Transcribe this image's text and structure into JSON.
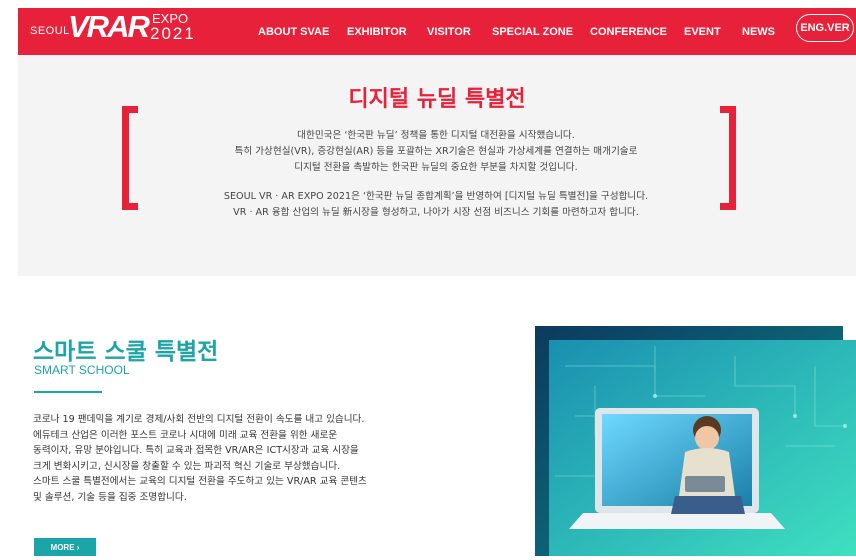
{
  "header": {
    "logo": {
      "seoul": "SEOUL",
      "vrar": "VRAR",
      "expo": "EXPO",
      "year": "2021"
    },
    "nav": [
      "ABOUT SVAE",
      "EXHIBITOR",
      "VISITOR",
      "SPECIAL ZONE",
      "CONFERENCE",
      "EVENT",
      "NEWS"
    ],
    "lang_button": "ENG.VER"
  },
  "intro": {
    "title": "디지털 뉴딜 특별전",
    "lines": [
      "대한민국은 ‘한국판 뉴딜’ 정책을 통한 디지털 대전환을 시작했습니다.",
      "특히 가상현실(VR), 증강현실(AR) 등을 포괄하는 XR기술은 현실과 가상세계를 연결하는 매개기술로",
      "디지털 전환을 촉발하는 한국판 뉴딜의 중요한 부분을 차지할 것입니다.",
      "SEOUL VR · AR EXPO 2021은 ‘한국판 뉴딜 종합계획’을 반영하여 [디지털 뉴딜 특별전]을 구성합니다.",
      "VR · AR 융합 산업의 뉴딜 新시장을 형성하고, 나아가 시장 선점 비즈니스 기회를 마련하고자 합니다."
    ]
  },
  "smart": {
    "title": "스마트 스쿨 특별전",
    "subtitle": "SMART SCHOOL",
    "lines": [
      "코로나 19 팬데믹을 계기로 경제/사회 전반의 디지털 전환이 속도를 내고 있습니다.",
      "에듀테크 산업은 이러한 포스트 코로나 시대에 미래 교육 전환을 위한 새로운",
      "동력이자, 유망 분야입니다. 특히 교육과 접목한 VR/AR은 ICT시장과 교육 시장을",
      "크게 변화시키고, 신시장을 창출할 수 있는 파괴적 혁신 기술로 부상했습니다.",
      "스마트 스쿨 특별전에서는 교육의 디지털 전환을 주도하고 있는 VR/AR 교육 콘텐츠",
      "및 솔루션, 기술 등을 집중 조명합니다."
    ],
    "more": "MORE ›"
  },
  "colors": {
    "brand_red": "#e8213a",
    "teal": "#1ca5a8"
  },
  "icons": [
    "chevron-right-icon"
  ]
}
